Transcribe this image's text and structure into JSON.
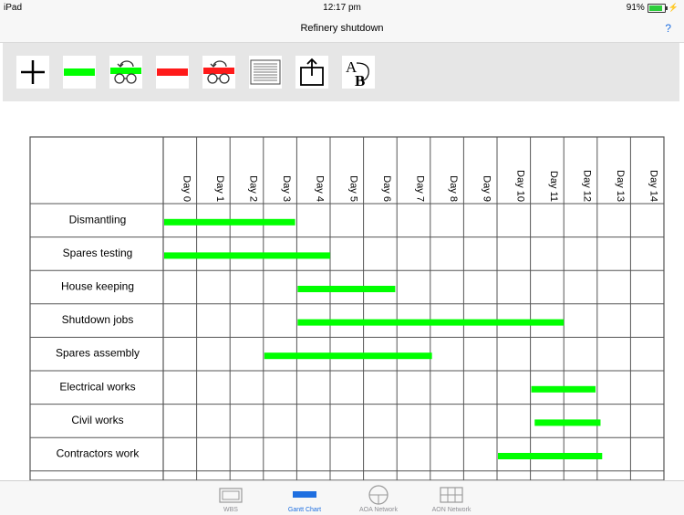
{
  "status": {
    "device": "iPad",
    "time": "12:17 pm",
    "battery": "91%",
    "battery_level": 0.91
  },
  "nav": {
    "title": "Refinery shutdown",
    "help": "?"
  },
  "toolbar": {
    "tools": [
      {
        "name": "add-tool",
        "icon": "plus-icon"
      },
      {
        "name": "add-link-tool",
        "icon": "green-bar-icon"
      },
      {
        "name": "undo-link-tool",
        "icon": "green-undo-glasses-icon"
      },
      {
        "name": "remove-link-tool",
        "icon": "red-bar-icon"
      },
      {
        "name": "undo-remove-tool",
        "icon": "red-undo-glasses-icon"
      },
      {
        "name": "list-tool",
        "icon": "list-icon"
      },
      {
        "name": "share-tool",
        "icon": "share-icon"
      },
      {
        "name": "text-tool",
        "icon": "ab-text-icon"
      }
    ]
  },
  "chart_data": {
    "type": "gantt",
    "days": [
      "Day 0",
      "Day 1",
      "Day 2",
      "Day 3",
      "Day 4",
      "Day 5",
      "Day 6",
      "Day 7",
      "Day 8",
      "Day 9",
      "Day 10",
      "Day 11",
      "Day 12",
      "Day 13",
      "Day 14"
    ],
    "bar_color": "#00ff00",
    "tasks": [
      {
        "name": "Dismantling",
        "start": 0,
        "end": 3.95
      },
      {
        "name": "Spares testing",
        "start": 0,
        "end": 5.0
      },
      {
        "name": "House keeping",
        "start": 4.0,
        "end": 6.95
      },
      {
        "name": "Shutdown jobs",
        "start": 4.0,
        "end": 12.0
      },
      {
        "name": "Spares assembly",
        "start": 3.0,
        "end": 8.05
      },
      {
        "name": "Electrical works",
        "start": 11.0,
        "end": 12.95
      },
      {
        "name": "Civil works",
        "start": 11.1,
        "end": 13.1
      },
      {
        "name": "Contractors work",
        "start": 10.0,
        "end": 13.15
      }
    ]
  },
  "tabs": [
    {
      "label": "WBS",
      "icon": "wbs-icon",
      "active": false
    },
    {
      "label": "Gantt Chart",
      "icon": "gantt-chart-icon",
      "active": true
    },
    {
      "label": "AOA Network",
      "icon": "aoa-network-icon",
      "active": false
    },
    {
      "label": "AON Network",
      "icon": "aon-network-icon",
      "active": false
    }
  ],
  "colors": {
    "accent": "#1f6fe0",
    "green": "#00ff00",
    "red": "#ff1a1a"
  }
}
